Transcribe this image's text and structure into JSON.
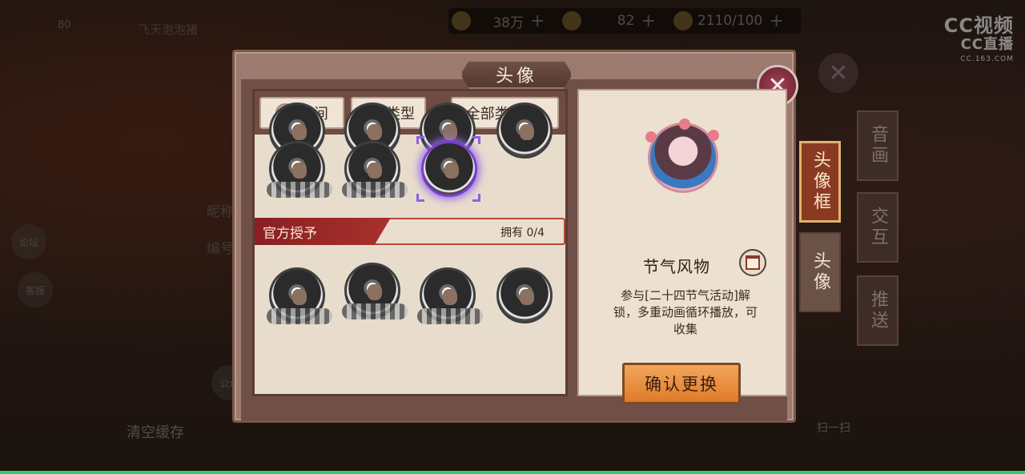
{
  "header": {
    "player_name": "飞天泡泡猪",
    "level": "80",
    "resources": [
      {
        "name": "gold",
        "value": "38万"
      },
      {
        "name": "jade",
        "value": "82"
      },
      {
        "name": "stamina",
        "value": "2110/100"
      }
    ]
  },
  "watermark": {
    "line1": "CC视频",
    "line2": "CC直播",
    "line3": "CC.163.COM"
  },
  "background": {
    "labels": [
      "昵称",
      "编号",
      "论坛",
      "客服",
      "公众"
    ],
    "clear_cache": "清空缓存",
    "scan": "扫一扫"
  },
  "dialog": {
    "title": "头像",
    "close_icon": "close-icon",
    "filters": {
      "time_label": "时间",
      "type_label": "类型",
      "category_label": "全部类别"
    },
    "section": {
      "name": "官方授予",
      "owned": "拥有 0/4"
    },
    "detail": {
      "frame_name": "节气风物",
      "description": "参与[二十四节气活动]解锁，多重动画循环播放，可收集",
      "confirm_label": "确认更换"
    },
    "tabs": [
      {
        "label": "音画"
      },
      {
        "label": "头像框"
      },
      {
        "label": "交互"
      },
      {
        "label": "头像"
      },
      {
        "label": "推送"
      }
    ]
  }
}
